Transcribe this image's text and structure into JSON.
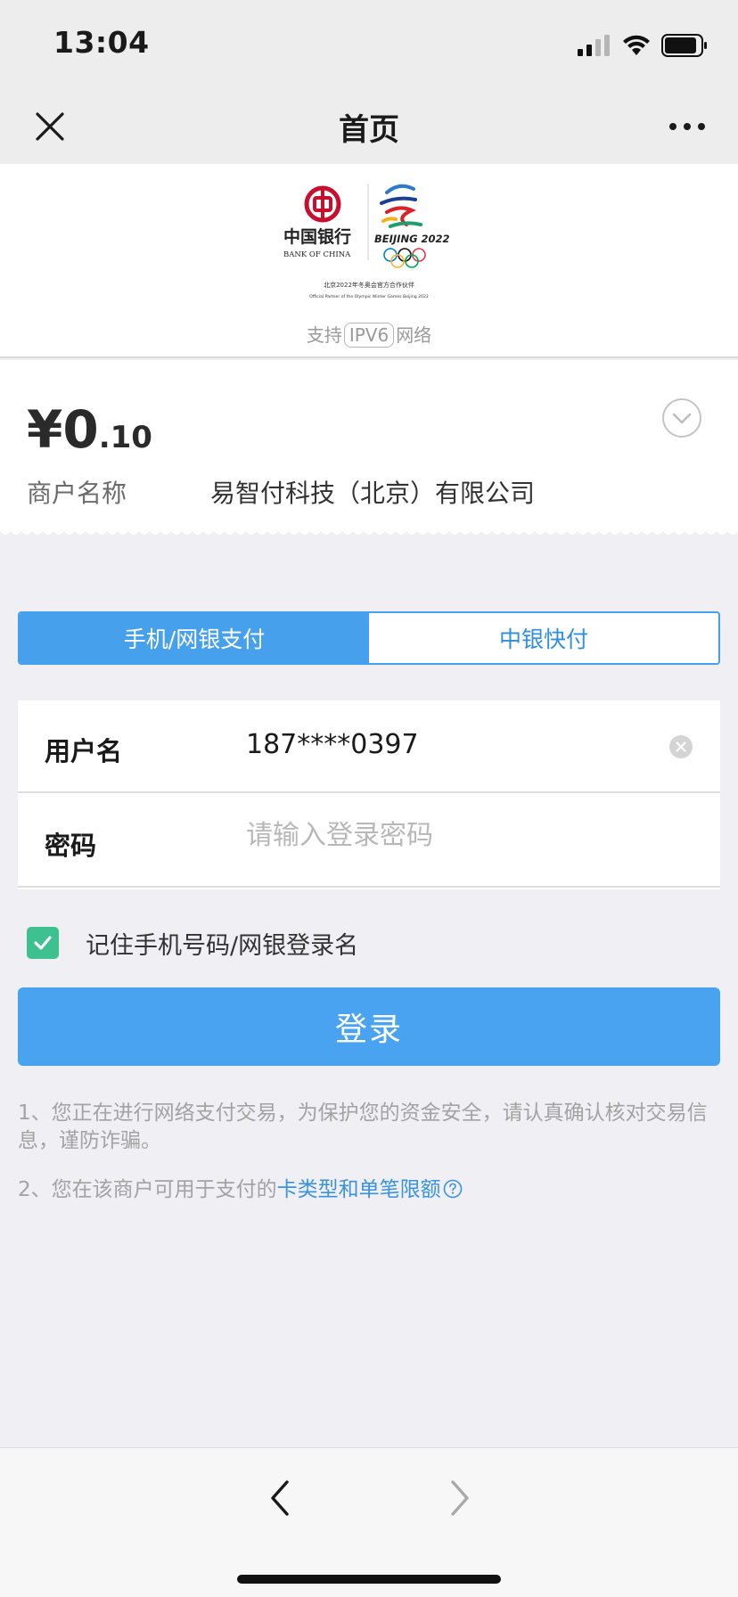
{
  "status": {
    "time": "13:04"
  },
  "nav": {
    "title": "首页"
  },
  "banner": {
    "bank_name_cn": "中国银行",
    "bank_name_en": "BANK OF CHINA",
    "games": "BEIJING 2022",
    "partner_cn": "北京2022年冬奥会官方合作伙伴",
    "partner_en": "Official Partner of the Olympic Winter Games Beijing 2022",
    "ipv6_prefix": "支持",
    "ipv6_tag": "IPV6",
    "ipv6_suffix": "网络"
  },
  "order": {
    "currency": "¥",
    "amount_int": "0",
    "amount_dec": ".10",
    "merchant_label": "商户名称",
    "merchant_name": "易智付科技（北京）有限公司"
  },
  "tabs": [
    {
      "label": "手机/网银支付",
      "active": true
    },
    {
      "label": "中银快付",
      "active": false
    }
  ],
  "form": {
    "username_label": "用户名",
    "username_value": "187****0397",
    "password_label": "密码",
    "password_placeholder": "请输入登录密码"
  },
  "remember": {
    "label": "记住手机号码/网银登录名",
    "checked": true
  },
  "login_button": "登录",
  "notes": {
    "note1": "1、您正在进行网络支付交易，为保护您的资金安全，请认真确认核对交易信息，谨防诈骗。",
    "note2_prefix": "2、您在该商户可用于支付的",
    "note2_link": "卡类型和单笔限额"
  },
  "colors": {
    "accent": "#46a0ec",
    "button": "#4aa3f0",
    "checkbox": "#3ec090",
    "link": "#3a93de",
    "bank_red": "#c8102e"
  }
}
